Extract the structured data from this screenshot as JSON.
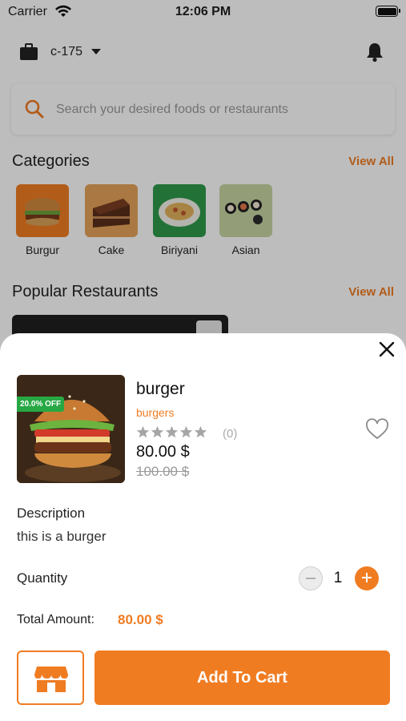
{
  "status_bar": {
    "carrier": "Carrier",
    "time": "12:06 PM"
  },
  "header": {
    "location": "c-175"
  },
  "search": {
    "placeholder": "Search your desired foods or restaurants"
  },
  "categories_section": {
    "title": "Categories",
    "view_all": "View All",
    "items": [
      {
        "label": "Burgur",
        "color": "#f07c22"
      },
      {
        "label": "Cake",
        "color": "#e6a35a"
      },
      {
        "label": "Biriyani",
        "color": "#2e9a4c"
      },
      {
        "label": "Asian",
        "color": "#c7d6a3"
      }
    ]
  },
  "restaurants_section": {
    "title": "Popular Restaurants",
    "view_all": "View All"
  },
  "product": {
    "name": "burger",
    "category": "burgers",
    "discount_badge": "20.0% OFF",
    "rating_stars": 0,
    "rating_count": "(0)",
    "price": "80.00 $",
    "old_price": "100.00 $"
  },
  "description": {
    "title": "Description",
    "text": "this is a burger"
  },
  "quantity": {
    "label": "Quantity",
    "value": "1"
  },
  "total": {
    "label": "Total Amount:",
    "value": "80.00 $"
  },
  "actions": {
    "add_to_cart": "Add To Cart"
  },
  "colors": {
    "accent": "#f07c22",
    "discount": "#27a844"
  }
}
